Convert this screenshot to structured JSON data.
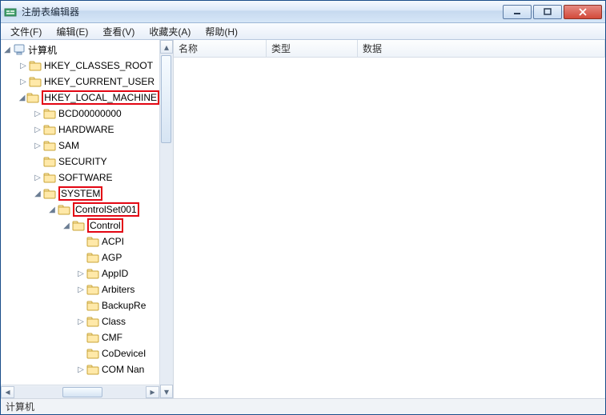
{
  "window": {
    "title": "注册表编辑器"
  },
  "menu": {
    "file": "文件(F)",
    "edit": "编辑(E)",
    "view": "查看(V)",
    "favorites": "收藏夹(A)",
    "help": "帮助(H)"
  },
  "tree": {
    "root": "计算机",
    "items": [
      {
        "label": "HKEY_CLASSES_ROOT",
        "indent": 1,
        "twisty": "closed",
        "hl": false
      },
      {
        "label": "HKEY_CURRENT_USER",
        "indent": 1,
        "twisty": "closed",
        "hl": false
      },
      {
        "label": "HKEY_LOCAL_MACHINE",
        "indent": 1,
        "twisty": "open",
        "hl": true
      },
      {
        "label": "BCD00000000",
        "indent": 2,
        "twisty": "closed",
        "hl": false
      },
      {
        "label": "HARDWARE",
        "indent": 2,
        "twisty": "closed",
        "hl": false
      },
      {
        "label": "SAM",
        "indent": 2,
        "twisty": "closed",
        "hl": false
      },
      {
        "label": "SECURITY",
        "indent": 2,
        "twisty": "none",
        "hl": false
      },
      {
        "label": "SOFTWARE",
        "indent": 2,
        "twisty": "closed",
        "hl": false
      },
      {
        "label": "SYSTEM",
        "indent": 2,
        "twisty": "open",
        "hl": true
      },
      {
        "label": "ControlSet001",
        "indent": 3,
        "twisty": "open",
        "hl": true
      },
      {
        "label": "Control",
        "indent": 4,
        "twisty": "open",
        "hl": true
      },
      {
        "label": "ACPI",
        "indent": 5,
        "twisty": "none",
        "hl": false
      },
      {
        "label": "AGP",
        "indent": 5,
        "twisty": "none",
        "hl": false
      },
      {
        "label": "AppID",
        "indent": 5,
        "twisty": "closed",
        "hl": false
      },
      {
        "label": "Arbiters",
        "indent": 5,
        "twisty": "closed",
        "hl": false
      },
      {
        "label": "BackupRe",
        "indent": 5,
        "twisty": "none",
        "hl": false
      },
      {
        "label": "Class",
        "indent": 5,
        "twisty": "closed",
        "hl": false
      },
      {
        "label": "CMF",
        "indent": 5,
        "twisty": "none",
        "hl": false
      },
      {
        "label": "CoDeviceI",
        "indent": 5,
        "twisty": "none",
        "hl": false
      },
      {
        "label": "COM Nan",
        "indent": 5,
        "twisty": "closed",
        "hl": false
      }
    ]
  },
  "columns": {
    "name": "名称",
    "type": "类型",
    "data": "数据"
  },
  "statusbar": {
    "path": "计算机"
  }
}
